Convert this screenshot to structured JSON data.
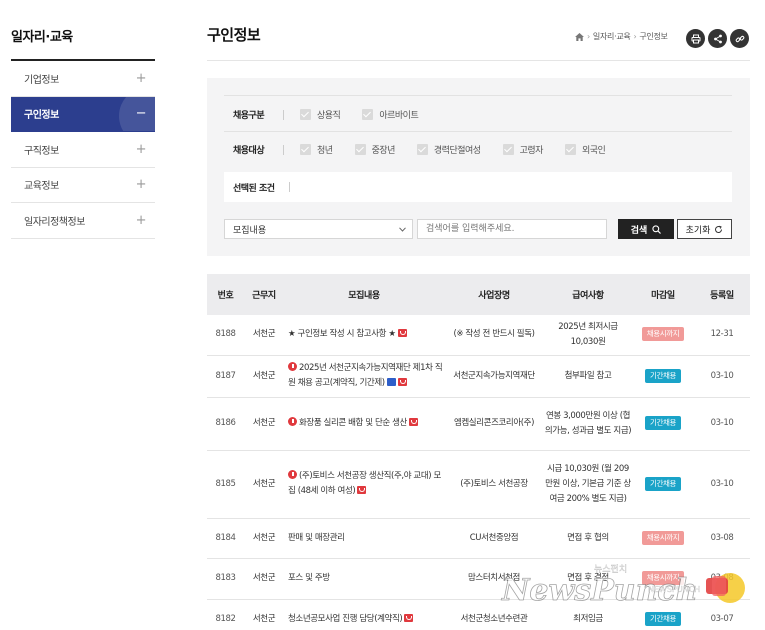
{
  "sidebar": {
    "title": "일자리·교육",
    "items": [
      {
        "label": "기업정보",
        "active": false
      },
      {
        "label": "구인정보",
        "active": true
      },
      {
        "label": "구직정보",
        "active": false
      },
      {
        "label": "교육정보",
        "active": false
      },
      {
        "label": "일자리정책정보",
        "active": false
      }
    ]
  },
  "header": {
    "title": "구인정보",
    "breadcrumb": [
      "일자리·교육",
      "구인정보"
    ],
    "buttons": [
      "print-icon",
      "share-icon",
      "link-icon"
    ]
  },
  "filter": {
    "employment_type": {
      "label": "채용구분",
      "options": [
        "상용직",
        "아르바이트"
      ]
    },
    "target": {
      "label": "채용대상",
      "options": [
        "청년",
        "중장년",
        "경력단절여성",
        "고령자",
        "외국인"
      ]
    },
    "selected_label": "선택된 조건",
    "search": {
      "select_value": "모집내용",
      "placeholder": "검색어를 입력해주세요.",
      "search_button": "검색",
      "reset_button": "초기화"
    }
  },
  "table": {
    "headers": [
      "번호",
      "근무지",
      "모집내용",
      "사업장명",
      "급여사항",
      "마감일",
      "등록일"
    ],
    "rows": [
      {
        "no": "8188",
        "loc": "서천군",
        "title": "★ 구인정보 작성 시 참고사항 ★",
        "company": "(※ 작성 전 반드시 필독)",
        "pay": "2025년 최저시급 10,030원",
        "deadline": "채용시까지",
        "date": "12-31"
      },
      {
        "no": "8187",
        "loc": "서천군",
        "title": "2025년 서천군지속가능지역재단 제1차 직원 채용 공고(계약직, 기간제)",
        "company": "서천군지속가능지역재단",
        "pay": "첨부파일 참고",
        "deadline": "기간채용",
        "date": "03-10"
      },
      {
        "no": "8186",
        "loc": "서천군",
        "title": "화장품 실리콘 배합 및 단순 생산",
        "company": "엠켐실리콘즈코리아(주)",
        "pay": "연봉 3,000만원 이상 (협의가능, 성과급 별도 지급)",
        "deadline": "기간채용",
        "date": "03-10"
      },
      {
        "no": "8185",
        "loc": "서천군",
        "title": "(주)토비스 서천공장 생산직(주,야 교대) 모집 (48세 이하 여성)",
        "company": "(주)토비스 서천공장",
        "pay": "시급 10,030원 (월 209만원 이상, 기본급 기준 상여금 200% 별도 지급)",
        "deadline": "기간채용",
        "date": "03-10"
      },
      {
        "no": "8184",
        "loc": "서천군",
        "title": "판매 및 매장관리",
        "company": "CU서천중앙점",
        "pay": "면접 후 협의",
        "deadline": "채용시까지",
        "date": "03-08"
      },
      {
        "no": "8183",
        "loc": "서천군",
        "title": "포스 및 주방",
        "company": "맘스터치서천점",
        "pay": "면접 후 결정",
        "deadline": "채용시까지",
        "date": "03-08"
      },
      {
        "no": "8182",
        "loc": "서천군",
        "title": "청소년공모사업 진행 담당(계약직)",
        "company": "서천군청소년수련관",
        "pay": "최저임금",
        "deadline": "기간채용",
        "date": "03-07"
      }
    ]
  },
  "watermark": {
    "text": "NewsPunch",
    "sub": "NEWSPUNCH",
    "korean": "뉴스펀치"
  },
  "colors": {
    "active_nav": "#2c3e8e",
    "badge_until_hired": "#f19a98",
    "badge_period": "#1aa3c8",
    "accent_red": "#e0393e"
  }
}
